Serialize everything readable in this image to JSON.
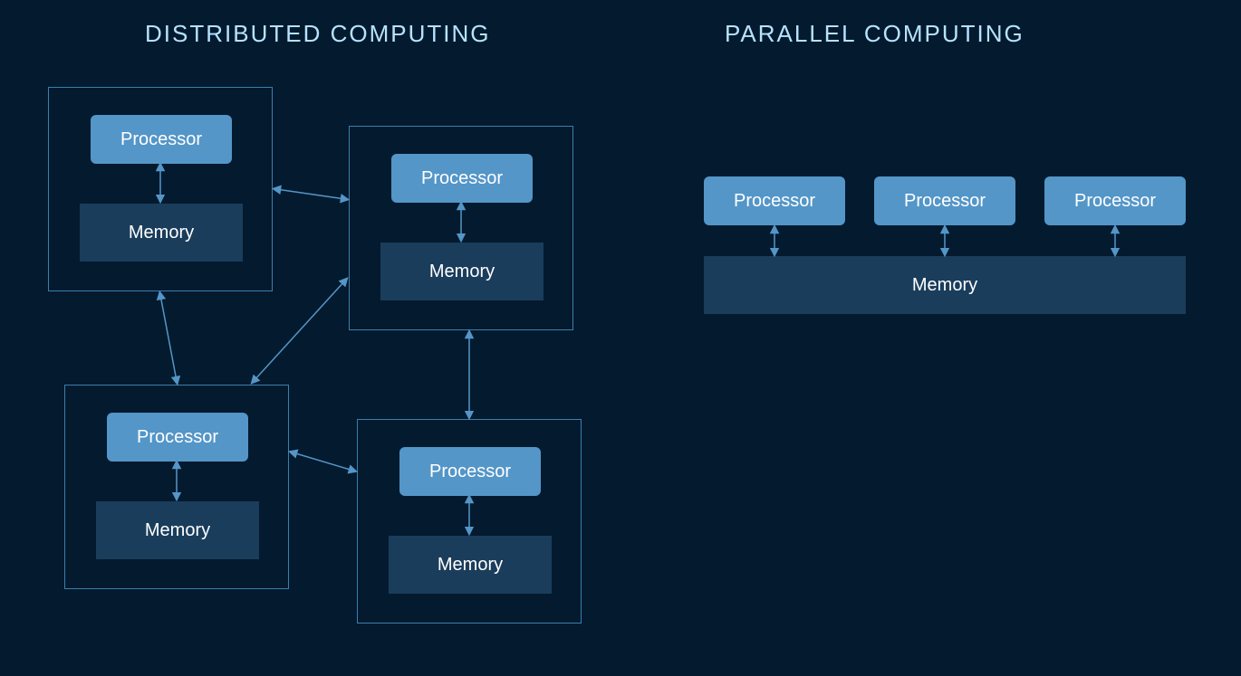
{
  "titles": {
    "distributed": "DISTRIBUTED COMPUTING",
    "parallel": "PARALLEL COMPUTING"
  },
  "labels": {
    "processor": "Processor",
    "memory": "Memory"
  }
}
